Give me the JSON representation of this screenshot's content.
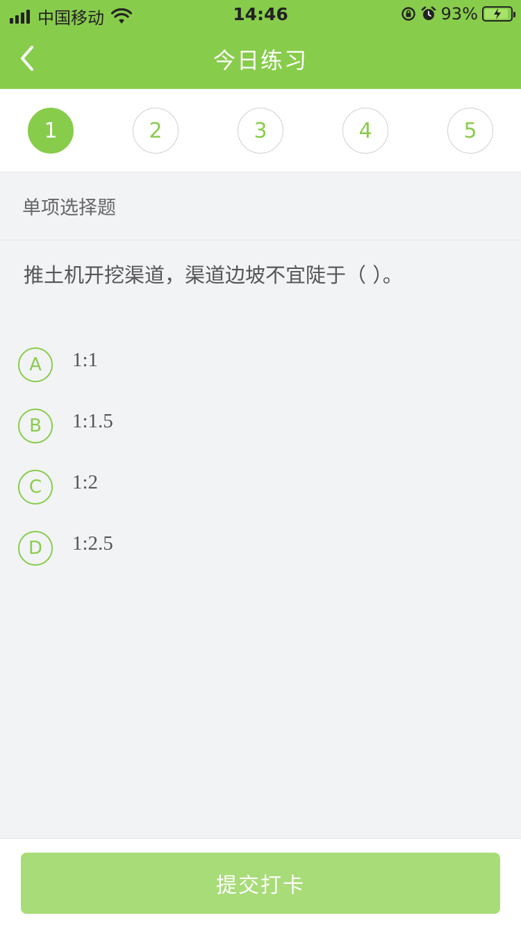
{
  "status_bar": {
    "carrier": "中国移动",
    "time": "14:46",
    "battery_percent": "93%"
  },
  "nav": {
    "title": "今日练习",
    "back_icon": "chevron-left-icon"
  },
  "question_tabs": [
    {
      "label": "1",
      "active": true
    },
    {
      "label": "2",
      "active": false
    },
    {
      "label": "3",
      "active": false
    },
    {
      "label": "4",
      "active": false
    },
    {
      "label": "5",
      "active": false
    }
  ],
  "question": {
    "type_label": "单项选择题",
    "text": "推土机开挖渠道，渠道边坡不宜陡于（    ）。",
    "options": [
      {
        "letter": "A",
        "text": "1:1"
      },
      {
        "letter": "B",
        "text": "1:1.5"
      },
      {
        "letter": "C",
        "text": "1:2"
      },
      {
        "letter": "D",
        "text": "1:2.5"
      }
    ]
  },
  "footer": {
    "submit_label": "提交打卡"
  },
  "colors": {
    "accent": "#88cc4c",
    "button_disabled": "#a8dc78",
    "background": "#f2f3f5"
  }
}
